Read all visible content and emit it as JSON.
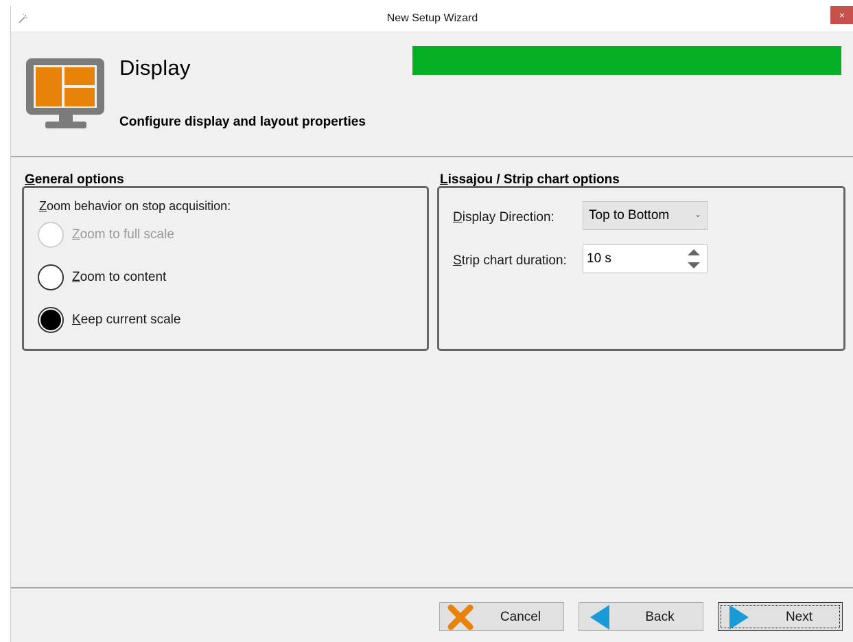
{
  "window": {
    "title": "New Setup Wizard",
    "close_glyph": "×"
  },
  "header": {
    "title": "Display",
    "subtitle": "Configure display and layout properties",
    "icon": "monitor-layout-icon",
    "progress_fraction": 1.0,
    "progress_color": "#06b025",
    "icon_accent_color": "#e8830a"
  },
  "general": {
    "group_label_first": "G",
    "group_label_rest": "eneral options",
    "legend_first": "Z",
    "legend_rest": "oom behavior on stop acquisition:",
    "options": [
      {
        "first": "Z",
        "rest": "oom to full scale",
        "checked": false,
        "disabled": true
      },
      {
        "first": "Z",
        "rest": "oom to content",
        "checked": false,
        "disabled": false
      },
      {
        "first": "K",
        "rest": "eep current scale",
        "checked": true,
        "disabled": false
      }
    ]
  },
  "lissajou": {
    "group_label_first": "L",
    "group_label_rest": "issajou / Strip chart options",
    "direction_label_first": "D",
    "direction_label_rest": "isplay Direction:",
    "direction_value": "Top to Bottom",
    "duration_label_first": "S",
    "duration_label_rest": "trip chart duration:",
    "duration_value": "10 s"
  },
  "footer": {
    "cancel_label": "Cancel",
    "back_label": "Back",
    "next_label": "Next"
  }
}
